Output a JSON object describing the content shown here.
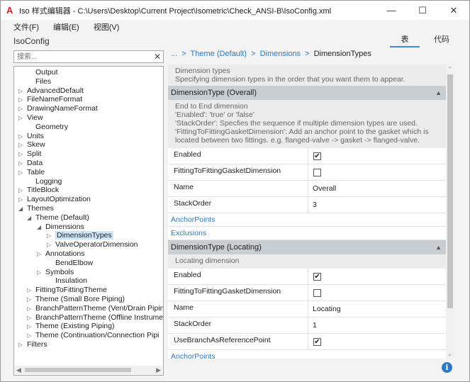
{
  "window": {
    "title": "Iso 样式编辑器 - C:\\Users\\Desktop\\Current Project\\Isometric\\Check_ANSI-B\\IsoConfig.xml",
    "app_icon": "autocad-a-icon",
    "minimize": "—",
    "maximize": "☐",
    "close": "✕"
  },
  "menu": [
    "文件(F)",
    "编辑(E)",
    "视图(V)"
  ],
  "app_name": "IsoConfig",
  "view_tabs": {
    "table": "表",
    "code": "代码"
  },
  "search": {
    "placeholder": "搜索...",
    "clear": "✕"
  },
  "tree": [
    {
      "label": "Output",
      "arrow": ""
    },
    {
      "label": "Files",
      "arrow": ""
    },
    {
      "label": "AdvancedDefault",
      "arrow": "▷"
    },
    {
      "label": "FileNameFormat",
      "arrow": "▷"
    },
    {
      "label": "DrawingNameFormat",
      "arrow": "▷"
    },
    {
      "label": "View",
      "arrow": "▷"
    },
    {
      "label": "Geometry",
      "arrow": ""
    },
    {
      "label": "Units",
      "arrow": "▷"
    },
    {
      "label": "Skew",
      "arrow": "▷"
    },
    {
      "label": "Split",
      "arrow": "▷"
    },
    {
      "label": "Data",
      "arrow": "▷"
    },
    {
      "label": "Table",
      "arrow": "▷"
    },
    {
      "label": "Logging",
      "arrow": ""
    },
    {
      "label": "TitleBlock",
      "arrow": "▷"
    },
    {
      "label": "LayoutOptimization",
      "arrow": "▷"
    },
    {
      "label": "Themes",
      "arrow": "◢"
    },
    {
      "label": "Theme (Default)",
      "arrow": "◢"
    },
    {
      "label": "Dimensions",
      "arrow": "◢"
    },
    {
      "label": "DimensionTypes",
      "arrow": "▷",
      "selected": true
    },
    {
      "label": "ValveOperatorDimension",
      "arrow": "▷"
    },
    {
      "label": "Annotations",
      "arrow": "▷"
    },
    {
      "label": "BendElbow",
      "arrow": ""
    },
    {
      "label": "Symbols",
      "arrow": "▷"
    },
    {
      "label": "Insulation",
      "arrow": ""
    },
    {
      "label": "FittingToFittingTheme",
      "arrow": "▷"
    },
    {
      "label": "Theme (Small Bore Piping)",
      "arrow": "▷"
    },
    {
      "label": "BranchPatternTheme (Vent/Drain Pipin",
      "arrow": "▷"
    },
    {
      "label": "BranchPatternTheme (Offline Instrume",
      "arrow": "▷"
    },
    {
      "label": "Theme (Existing Piping)",
      "arrow": "▷"
    },
    {
      "label": "Theme (Continuation/Connection Pipi",
      "arrow": "▷"
    },
    {
      "label": "Filters",
      "arrow": "▷"
    }
  ],
  "breadcrumb": {
    "ellipsis": "...",
    "items": [
      "Theme (Default)",
      "Dimensions"
    ],
    "separator": ">",
    "current": "DimensionTypes"
  },
  "grid": {
    "top_desc": [
      "Dimension types",
      "Specifying dimension types in the order that you want them to appear."
    ],
    "sections": [
      {
        "header": "DimensionType (Overall)",
        "desc": [
          "End to End dimension",
          "'Enabled': 'true' or 'false'",
          "'StackOrder': Specfies the sequence if multiple dimension types are used.",
          "'FittingToFittingGasketDimension': Add an anchor point to the gasket which is",
          "located between two fittings. e.g. flanged-valve -> gasket -> flanged-valve."
        ],
        "rows": [
          {
            "name": "Enabled",
            "type": "checkbox",
            "checked": true
          },
          {
            "name": "FittingToFittingGasketDimension",
            "type": "checkbox",
            "checked": false
          },
          {
            "name": "Name",
            "type": "text",
            "value": "Overall"
          },
          {
            "name": "StackOrder",
            "type": "text",
            "value": "3"
          }
        ],
        "links": [
          "AnchorPoints",
          "Exclusions"
        ]
      },
      {
        "header": "DimensionType (Locating)",
        "desc": [
          "Locating dimension"
        ],
        "rows": [
          {
            "name": "Enabled",
            "type": "checkbox",
            "checked": true
          },
          {
            "name": "FittingToFittingGasketDimension",
            "type": "checkbox",
            "checked": false
          },
          {
            "name": "Name",
            "type": "text",
            "value": "Locating"
          },
          {
            "name": "StackOrder",
            "type": "text",
            "value": "1"
          },
          {
            "name": "UseBranchAsReferencePoint",
            "type": "checkbox",
            "checked": true
          }
        ],
        "links": [
          "AnchorPoints"
        ]
      }
    ],
    "collapse_glyph": "▲"
  },
  "colors": {
    "link": "#2b79c2",
    "section_header": "#c9ced3",
    "selection": "#cde5f7",
    "info": "#2b79c2"
  },
  "info_icon": "i"
}
